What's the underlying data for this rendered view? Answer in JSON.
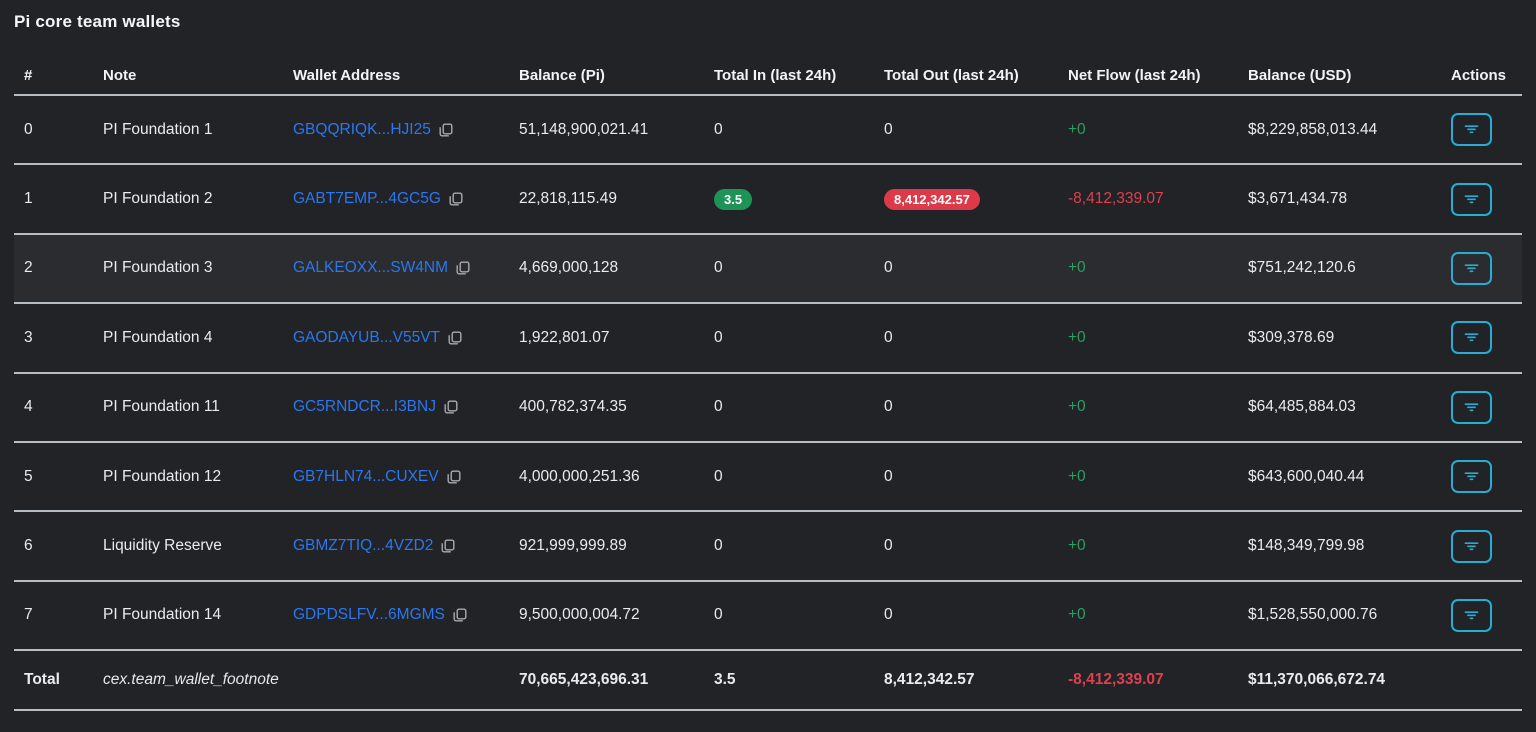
{
  "page": {
    "title": "Pi core team wallets"
  },
  "colors": {
    "page_bg": "#212326",
    "row_highlight": "#2a2c2f",
    "text_primary": "#e9ecef",
    "divider": "#b6bcc3",
    "link_blue": "#2b77f0",
    "positive_green": "#2e9d62",
    "negative_red": "#dc4150",
    "badge_green_bg": "#1e9358",
    "badge_red_bg": "#dc3a48",
    "action_cyan": "#29abd4",
    "icon_gray": "#a6abb0"
  },
  "icons": {
    "copy": "copy-icon",
    "filter": "filter-icon"
  },
  "table": {
    "columns": [
      "#",
      "Note",
      "Wallet Address",
      "Balance (Pi)",
      "Total In (last 24h)",
      "Total Out (last 24h)",
      "Net Flow (last 24h)",
      "Balance (USD)",
      "Actions"
    ],
    "rows": [
      {
        "index": "0",
        "note": "PI Foundation 1",
        "address": "GBQQRIQK...HJI25",
        "balance_pi": "51,148,900,021.41",
        "total_in": "0",
        "in_style": "plain",
        "total_out": "0",
        "out_style": "plain",
        "net_flow": "+0",
        "net_style": "pos",
        "balance_usd": "$8,229,858,013.44",
        "highlight": false
      },
      {
        "index": "1",
        "note": "PI Foundation 2",
        "address": "GABT7EMP...4GC5G",
        "balance_pi": "22,818,115.49",
        "total_in": "3.5",
        "in_style": "badge-green",
        "total_out": "8,412,342.57",
        "out_style": "badge-red",
        "net_flow": "-8,412,339.07",
        "net_style": "neg",
        "balance_usd": "$3,671,434.78",
        "highlight": false
      },
      {
        "index": "2",
        "note": "PI Foundation 3",
        "address": "GALKEOXX...SW4NM",
        "balance_pi": "4,669,000,128",
        "total_in": "0",
        "in_style": "plain",
        "total_out": "0",
        "out_style": "plain",
        "net_flow": "+0",
        "net_style": "pos",
        "balance_usd": "$751,242,120.6",
        "highlight": true
      },
      {
        "index": "3",
        "note": "PI Foundation 4",
        "address": "GAODAYUB...V55VT",
        "balance_pi": "1,922,801.07",
        "total_in": "0",
        "in_style": "plain",
        "total_out": "0",
        "out_style": "plain",
        "net_flow": "+0",
        "net_style": "pos",
        "balance_usd": "$309,378.69",
        "highlight": false
      },
      {
        "index": "4",
        "note": "PI Foundation 11",
        "address": "GC5RNDCR...I3BNJ",
        "balance_pi": "400,782,374.35",
        "total_in": "0",
        "in_style": "plain",
        "total_out": "0",
        "out_style": "plain",
        "net_flow": "+0",
        "net_style": "pos",
        "balance_usd": "$64,485,884.03",
        "highlight": false
      },
      {
        "index": "5",
        "note": "PI Foundation 12",
        "address": "GB7HLN74...CUXEV",
        "balance_pi": "4,000,000,251.36",
        "total_in": "0",
        "in_style": "plain",
        "total_out": "0",
        "out_style": "plain",
        "net_flow": "+0",
        "net_style": "pos",
        "balance_usd": "$643,600,040.44",
        "highlight": false
      },
      {
        "index": "6",
        "note": "Liquidity Reserve",
        "address": "GBMZ7TIQ...4VZD2",
        "balance_pi": "921,999,999.89",
        "total_in": "0",
        "in_style": "plain",
        "total_out": "0",
        "out_style": "plain",
        "net_flow": "+0",
        "net_style": "pos",
        "balance_usd": "$148,349,799.98",
        "highlight": false
      },
      {
        "index": "7",
        "note": "PI Foundation 14",
        "address": "GDPDSLFV...6MGMS",
        "balance_pi": "9,500,000,004.72",
        "total_in": "0",
        "in_style": "plain",
        "total_out": "0",
        "out_style": "plain",
        "net_flow": "+0",
        "net_style": "pos",
        "balance_usd": "$1,528,550,000.76",
        "highlight": false
      }
    ],
    "total": {
      "label": "Total",
      "footnote": "cex.team_wallet_footnote",
      "balance_pi": "70,665,423,696.31",
      "total_in": "3.5",
      "total_out": "8,412,342.57",
      "net_flow": "-8,412,339.07",
      "balance_usd": "$11,370,066,672.74"
    }
  }
}
